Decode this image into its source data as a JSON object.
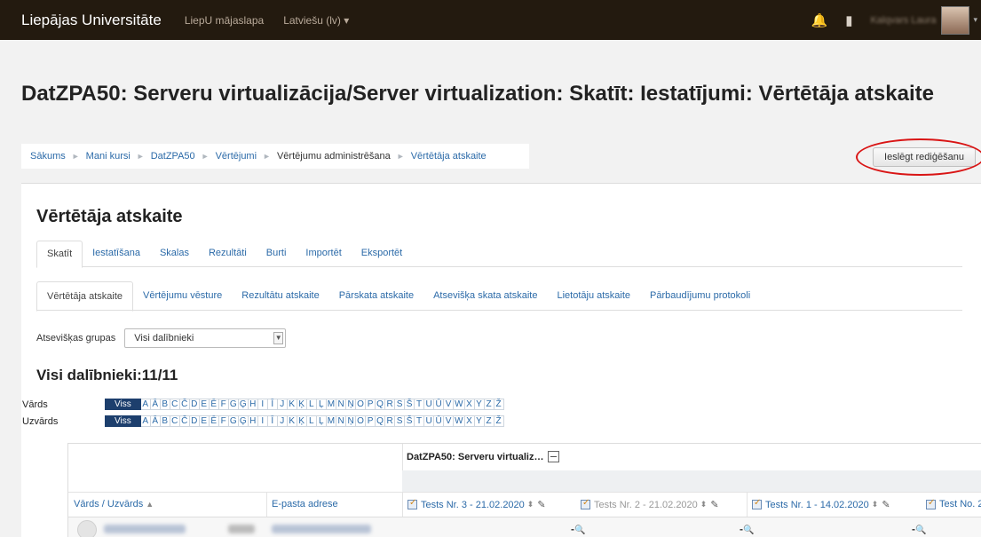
{
  "navbar": {
    "brand": "Liepājas Universitāte",
    "home_link": "LiepU mājaslapa",
    "language": "Latviešu (lv) ▾",
    "bell_icon": "bell-icon",
    "message_icon": "message-icon",
    "user_name": "Kalqvars Laura",
    "user_caret": "▾"
  },
  "page": {
    "title": "DatZPA50: Serveru virtualizācija/Server virtualization: Skatīt: Iestatījumi: Vērtētāja atskaite"
  },
  "breadcrumb": {
    "separator": "►",
    "items": [
      "Sākums",
      "Mani kursi",
      "DatZPA50",
      "Vērtējumi",
      "Vērtējumu administrēšana",
      "Vērtētāja atskaite"
    ]
  },
  "edit_button": "Ieslēgt rediģēšanu",
  "report": {
    "heading": "Vērtētāja atskaite",
    "tabs": [
      "Skatīt",
      "Iestatīšana",
      "Skalas",
      "Rezultāti",
      "Burti",
      "Importēt",
      "Eksportēt"
    ],
    "subtabs": [
      "Vērtētāja atskaite",
      "Vērtējumu vēsture",
      "Rezultātu atskaite",
      "Pārskata atskaite",
      "Atsevišķa skata atskaite",
      "Lietotāju atskaite",
      "Pārbaudījumu protokoli"
    ],
    "groups_label": "Atsevišķas grupas",
    "groups_value": "Visi dalībnieki",
    "count_heading": "Visi dalībnieki:11/11"
  },
  "initials": {
    "first_label": "Vārds",
    "last_label": "Uzvārds",
    "all": "Viss",
    "letters": [
      "A",
      "Ā",
      "B",
      "C",
      "Č",
      "D",
      "E",
      "Ē",
      "F",
      "G",
      "Ģ",
      "H",
      "I",
      "Ī",
      "J",
      "K",
      "Ķ",
      "L",
      "Ļ",
      "M",
      "N",
      "Ņ",
      "O",
      "P",
      "Q",
      "R",
      "S",
      "Š",
      "T",
      "U",
      "Ū",
      "V",
      "W",
      "X",
      "Y",
      "Z",
      "Ž"
    ]
  },
  "grader_table": {
    "category": "DatZPA50: Serveru virtualiz…",
    "col_name": "Vārds / Uzvārds",
    "col_name_sort": "▲",
    "col_email": "E-pasta adrese",
    "items": [
      {
        "label": "Tests Nr. 3 - 21.02.2020",
        "style": "link"
      },
      {
        "label": "Tests Nr. 2 - 21.02.2020",
        "style": "muted"
      },
      {
        "label": "Tests Nr. 1 - 14.02.2020",
        "style": "link"
      },
      {
        "label": "Test No. 2",
        "style": "link"
      }
    ],
    "sort_glyph": "⬍",
    "pencil_glyph": "✎",
    "row1_grades": [
      "-",
      "-",
      "-"
    ],
    "grade_icon": "🔍"
  }
}
